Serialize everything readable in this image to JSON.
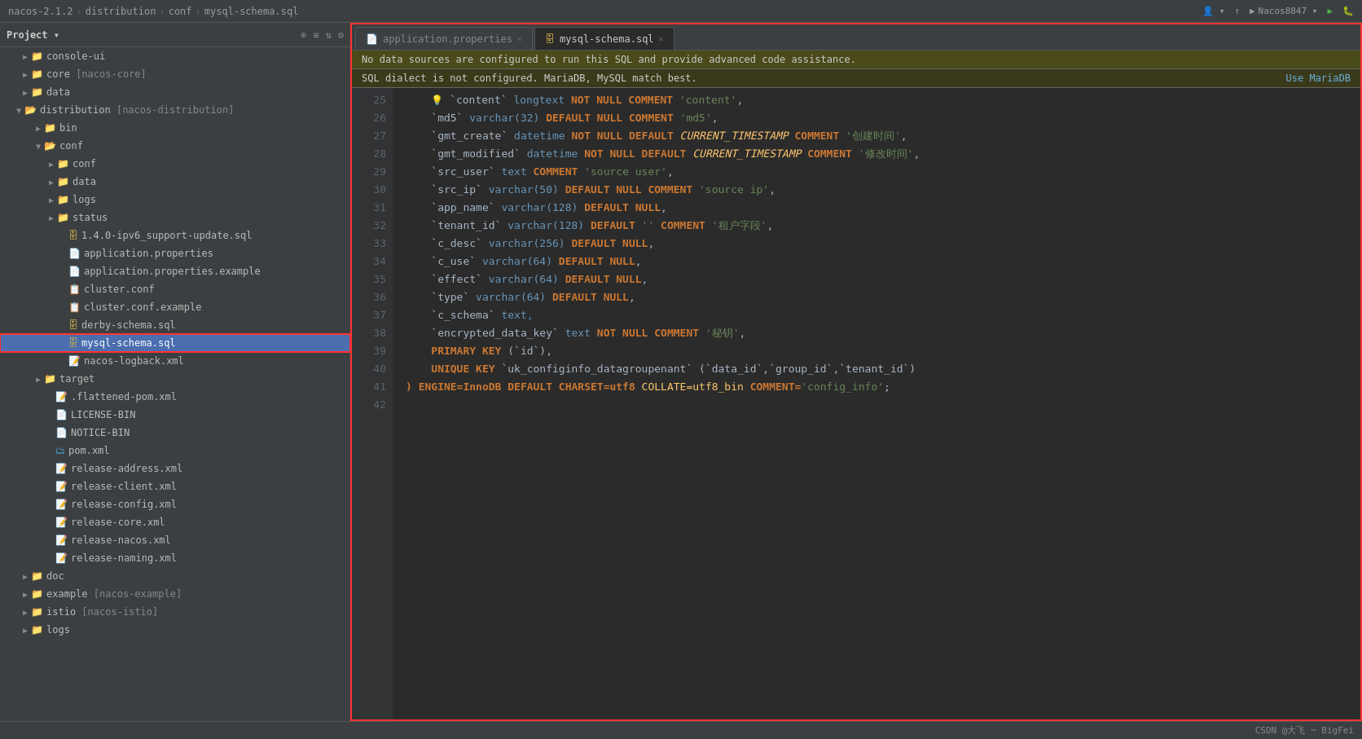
{
  "titlebar": {
    "breadcrumb": [
      "nacos-2.1.2",
      "distribution",
      "conf",
      "mysql-schema.sql"
    ],
    "right_buttons": [
      "user-icon",
      "up-arrow",
      "run-button",
      "nacos8847",
      "play-icon",
      "debug-icon"
    ]
  },
  "sidebar": {
    "title": "Project",
    "tree": [
      {
        "id": "console-ui",
        "label": "console-ui",
        "type": "folder",
        "depth": 1,
        "expanded": false
      },
      {
        "id": "core-nacos-core",
        "label": "core [nacos-core]",
        "type": "folder",
        "depth": 1,
        "expanded": false
      },
      {
        "id": "data",
        "label": "data",
        "type": "folder",
        "depth": 1,
        "expanded": false
      },
      {
        "id": "distribution-nacos-distribution",
        "label": "distribution [nacos-distribution]",
        "type": "folder",
        "depth": 1,
        "expanded": true
      },
      {
        "id": "bin",
        "label": "bin",
        "type": "folder",
        "depth": 2,
        "expanded": false
      },
      {
        "id": "conf",
        "label": "conf",
        "type": "folder",
        "depth": 2,
        "expanded": true
      },
      {
        "id": "conf-sub",
        "label": "conf",
        "type": "folder",
        "depth": 3,
        "expanded": false
      },
      {
        "id": "data-sub",
        "label": "data",
        "type": "folder",
        "depth": 3,
        "expanded": false
      },
      {
        "id": "logs",
        "label": "logs",
        "type": "folder",
        "depth": 3,
        "expanded": false
      },
      {
        "id": "status",
        "label": "status",
        "type": "folder",
        "depth": 3,
        "expanded": false
      },
      {
        "id": "1-4-0-ipv6",
        "label": "1.4.0-ipv6_support-update.sql",
        "type": "file-sql",
        "depth": 3
      },
      {
        "id": "application-properties",
        "label": "application.properties",
        "type": "file-prop",
        "depth": 3
      },
      {
        "id": "application-properties-example",
        "label": "application.properties.example",
        "type": "file-prop",
        "depth": 3
      },
      {
        "id": "cluster-conf",
        "label": "cluster.conf",
        "type": "file-conf",
        "depth": 3
      },
      {
        "id": "cluster-conf-example",
        "label": "cluster.conf.example",
        "type": "file-conf",
        "depth": 3
      },
      {
        "id": "derby-schema-sql",
        "label": "derby-schema.sql",
        "type": "file-sql",
        "depth": 3
      },
      {
        "id": "mysql-schema-sql",
        "label": "mysql-schema.sql",
        "type": "file-sql",
        "depth": 3,
        "selected": true,
        "highlighted": true
      },
      {
        "id": "nacos-logback-xml",
        "label": "nacos-logback.xml",
        "type": "file-xml",
        "depth": 3
      },
      {
        "id": "target",
        "label": "target",
        "type": "folder",
        "depth": 2,
        "expanded": false
      },
      {
        "id": "flattened-pom-xml",
        "label": ".flattened-pom.xml",
        "type": "file-xml",
        "depth": 2
      },
      {
        "id": "license-bin",
        "label": "LICENSE-BIN",
        "type": "file-txt",
        "depth": 2
      },
      {
        "id": "notice-bin",
        "label": "NOTICE-BIN",
        "type": "file-txt",
        "depth": 2
      },
      {
        "id": "pom-xml",
        "label": "pom.xml",
        "type": "file-xml",
        "depth": 2
      },
      {
        "id": "release-address-xml",
        "label": "release-address.xml",
        "type": "file-xml",
        "depth": 2
      },
      {
        "id": "release-client-xml",
        "label": "release-client.xml",
        "type": "file-xml",
        "depth": 2
      },
      {
        "id": "release-config-xml",
        "label": "release-config.xml",
        "type": "file-xml",
        "depth": 2
      },
      {
        "id": "release-core-xml",
        "label": "release-core.xml",
        "type": "file-xml",
        "depth": 2
      },
      {
        "id": "release-nacos-xml",
        "label": "release-nacos.xml",
        "type": "file-xml",
        "depth": 2
      },
      {
        "id": "release-naming-xml",
        "label": "release-naming.xml",
        "type": "file-xml",
        "depth": 2
      },
      {
        "id": "doc",
        "label": "doc",
        "type": "folder",
        "depth": 1,
        "expanded": false
      },
      {
        "id": "example-nacos-example",
        "label": "example [nacos-example]",
        "type": "folder",
        "depth": 1,
        "expanded": false
      },
      {
        "id": "istio-nacos-istio",
        "label": "istio [nacos-istio]",
        "type": "folder",
        "depth": 1,
        "expanded": false
      },
      {
        "id": "logs-root",
        "label": "logs",
        "type": "folder",
        "depth": 1,
        "expanded": false
      }
    ]
  },
  "editor": {
    "tabs": [
      {
        "id": "application-properties",
        "label": "application.properties",
        "active": false,
        "type": "prop"
      },
      {
        "id": "mysql-schema-sql",
        "label": "mysql-schema.sql",
        "active": true,
        "type": "sql"
      }
    ],
    "warnings": [
      {
        "text": "No data sources are configured to run this SQL and provide advanced code assistance.",
        "link": null
      },
      {
        "text": "SQL dialect is not configured. MariaDB, MySQL match best.",
        "link": "Use MariaDB"
      }
    ],
    "lines": [
      {
        "num": 25,
        "tokens": [
          {
            "t": "    ",
            "c": "plain"
          },
          {
            "t": "💡",
            "c": "lightbulb"
          },
          {
            "t": " `content`",
            "c": "backtick"
          },
          {
            "t": " longtext ",
            "c": "kw-blue"
          },
          {
            "t": "NOT NULL",
            "c": "kw"
          },
          {
            "t": " COMMENT ",
            "c": "kw"
          },
          {
            "t": "'content'",
            "c": "str"
          },
          {
            "t": ",",
            "c": "plain"
          }
        ]
      },
      {
        "num": 26,
        "tokens": [
          {
            "t": "    `md5`",
            "c": "backtick"
          },
          {
            "t": " varchar(32) ",
            "c": "kw-blue"
          },
          {
            "t": "DEFAULT ",
            "c": "kw"
          },
          {
            "t": "NU",
            "c": "kw"
          },
          {
            "t": "LL",
            "c": "kw"
          },
          {
            "t": " COMMENT ",
            "c": "kw"
          },
          {
            "t": "'md5'",
            "c": "str"
          },
          {
            "t": ",",
            "c": "plain"
          }
        ]
      },
      {
        "num": 27,
        "tokens": [
          {
            "t": "    `gmt_create`",
            "c": "backtick"
          },
          {
            "t": " datetime ",
            "c": "kw-blue"
          },
          {
            "t": "NOT NULL",
            "c": "kw"
          },
          {
            "t": " DEFAULT ",
            "c": "kw"
          },
          {
            "t": "CURRENT_TIMESTAMP",
            "c": "fn"
          },
          {
            "t": " COMMENT ",
            "c": "kw"
          },
          {
            "t": "'创建时间'",
            "c": "str"
          },
          {
            "t": ",",
            "c": "plain"
          }
        ]
      },
      {
        "num": 28,
        "tokens": [
          {
            "t": "    `gmt_modified`",
            "c": "backtick"
          },
          {
            "t": " datetime ",
            "c": "kw-blue"
          },
          {
            "t": "NOT NULL",
            "c": "kw"
          },
          {
            "t": " DEFAULT ",
            "c": "kw"
          },
          {
            "t": "CURRENT_TIMESTAMP",
            "c": "fn"
          },
          {
            "t": " COMMENT ",
            "c": "kw"
          },
          {
            "t": "'修改时间'",
            "c": "str"
          },
          {
            "t": ",",
            "c": "plain"
          }
        ]
      },
      {
        "num": 29,
        "tokens": [
          {
            "t": "    `src_user`",
            "c": "backtick"
          },
          {
            "t": " text ",
            "c": "kw-blue"
          },
          {
            "t": "COMMENT ",
            "c": "kw"
          },
          {
            "t": "'source user'",
            "c": "str"
          },
          {
            "t": ",",
            "c": "plain"
          }
        ]
      },
      {
        "num": 30,
        "tokens": [
          {
            "t": "    `src_ip`",
            "c": "backtick"
          },
          {
            "t": " varchar(50) ",
            "c": "kw-blue"
          },
          {
            "t": "DEFAULT NULL",
            "c": "kw"
          },
          {
            "t": " COMMENT ",
            "c": "kw"
          },
          {
            "t": "'source ip'",
            "c": "str"
          },
          {
            "t": ",",
            "c": "plain"
          }
        ]
      },
      {
        "num": 31,
        "tokens": [
          {
            "t": "    `app_name`",
            "c": "backtick"
          },
          {
            "t": " varchar(128) ",
            "c": "kw-blue"
          },
          {
            "t": "DEFAULT NULL",
            "c": "kw"
          },
          {
            "t": ",",
            "c": "plain"
          }
        ]
      },
      {
        "num": 32,
        "tokens": [
          {
            "t": "    `tenant_id`",
            "c": "backtick"
          },
          {
            "t": " varchar(128) ",
            "c": "kw-blue"
          },
          {
            "t": "DEFAULT ",
            "c": "kw"
          },
          {
            "t": "''",
            "c": "str"
          },
          {
            "t": " COMMENT ",
            "c": "kw"
          },
          {
            "t": "'租户字段'",
            "c": "str"
          },
          {
            "t": ",",
            "c": "plain"
          }
        ]
      },
      {
        "num": 33,
        "tokens": [
          {
            "t": "    `c_desc`",
            "c": "backtick"
          },
          {
            "t": " varchar(256) ",
            "c": "kw-blue"
          },
          {
            "t": "DEFAULT NULL",
            "c": "kw"
          },
          {
            "t": ",",
            "c": "plain"
          }
        ]
      },
      {
        "num": 34,
        "tokens": [
          {
            "t": "    `c_use`",
            "c": "backtick"
          },
          {
            "t": " varchar(64) ",
            "c": "kw-blue"
          },
          {
            "t": "DEFAULT NULL",
            "c": "kw"
          },
          {
            "t": ",",
            "c": "plain"
          }
        ]
      },
      {
        "num": 35,
        "tokens": [
          {
            "t": "    `effect`",
            "c": "backtick"
          },
          {
            "t": " varchar(64) ",
            "c": "kw-blue"
          },
          {
            "t": "DEFAULT NULL",
            "c": "kw"
          },
          {
            "t": ",",
            "c": "plain"
          }
        ]
      },
      {
        "num": 36,
        "tokens": [
          {
            "t": "    `type`",
            "c": "backtick"
          },
          {
            "t": " varchar(64) ",
            "c": "kw-blue"
          },
          {
            "t": "DEFAULT NULL",
            "c": "kw"
          },
          {
            "t": ",",
            "c": "plain"
          }
        ]
      },
      {
        "num": 37,
        "tokens": [
          {
            "t": "    `c_schema`",
            "c": "backtick"
          },
          {
            "t": " text,",
            "c": "kw-blue"
          }
        ]
      },
      {
        "num": 38,
        "tokens": [
          {
            "t": "    `encrypted_data_key`",
            "c": "backtick"
          },
          {
            "t": " text ",
            "c": "kw-blue"
          },
          {
            "t": "NOT NULL",
            "c": "kw"
          },
          {
            "t": " COMMENT ",
            "c": "kw"
          },
          {
            "t": "'秘钥'",
            "c": "str"
          },
          {
            "t": ",",
            "c": "plain"
          }
        ]
      },
      {
        "num": 39,
        "tokens": [
          {
            "t": "    PRIMARY KEY ",
            "c": "kw"
          },
          {
            "t": "(`id`)",
            "c": "backtick"
          },
          {
            "t": ",",
            "c": "plain"
          }
        ]
      },
      {
        "num": 40,
        "tokens": [
          {
            "t": "    UNIQUE KEY ",
            "c": "kw"
          },
          {
            "t": "`uk_configinfo_datagroupenant`",
            "c": "backtick"
          },
          {
            "t": " (",
            "c": "plain"
          },
          {
            "t": "`data_id`",
            "c": "backtick"
          },
          {
            "t": ",",
            "c": "plain"
          },
          {
            "t": "`group_id`",
            "c": "backtick"
          },
          {
            "t": ",",
            "c": "plain"
          },
          {
            "t": "`tenant_id`",
            "c": "backtick"
          },
          {
            "t": ")",
            "c": "plain"
          }
        ]
      },
      {
        "num": 41,
        "tokens": [
          {
            "t": ") ENGINE=InnoDB ",
            "c": "kw"
          },
          {
            "t": "DEFAULT CHARSET=utf8 ",
            "c": "kw"
          },
          {
            "t": "COLLATE=utf8_bin ",
            "c": "special"
          },
          {
            "t": "COMMENT=",
            "c": "kw"
          },
          {
            "t": "'config_info'",
            "c": "str"
          },
          {
            "t": ";",
            "c": "plain"
          }
        ]
      },
      {
        "num": 42,
        "tokens": []
      }
    ]
  },
  "statusbar": {
    "text": "CSDN @大飞 ~ BigFei"
  }
}
